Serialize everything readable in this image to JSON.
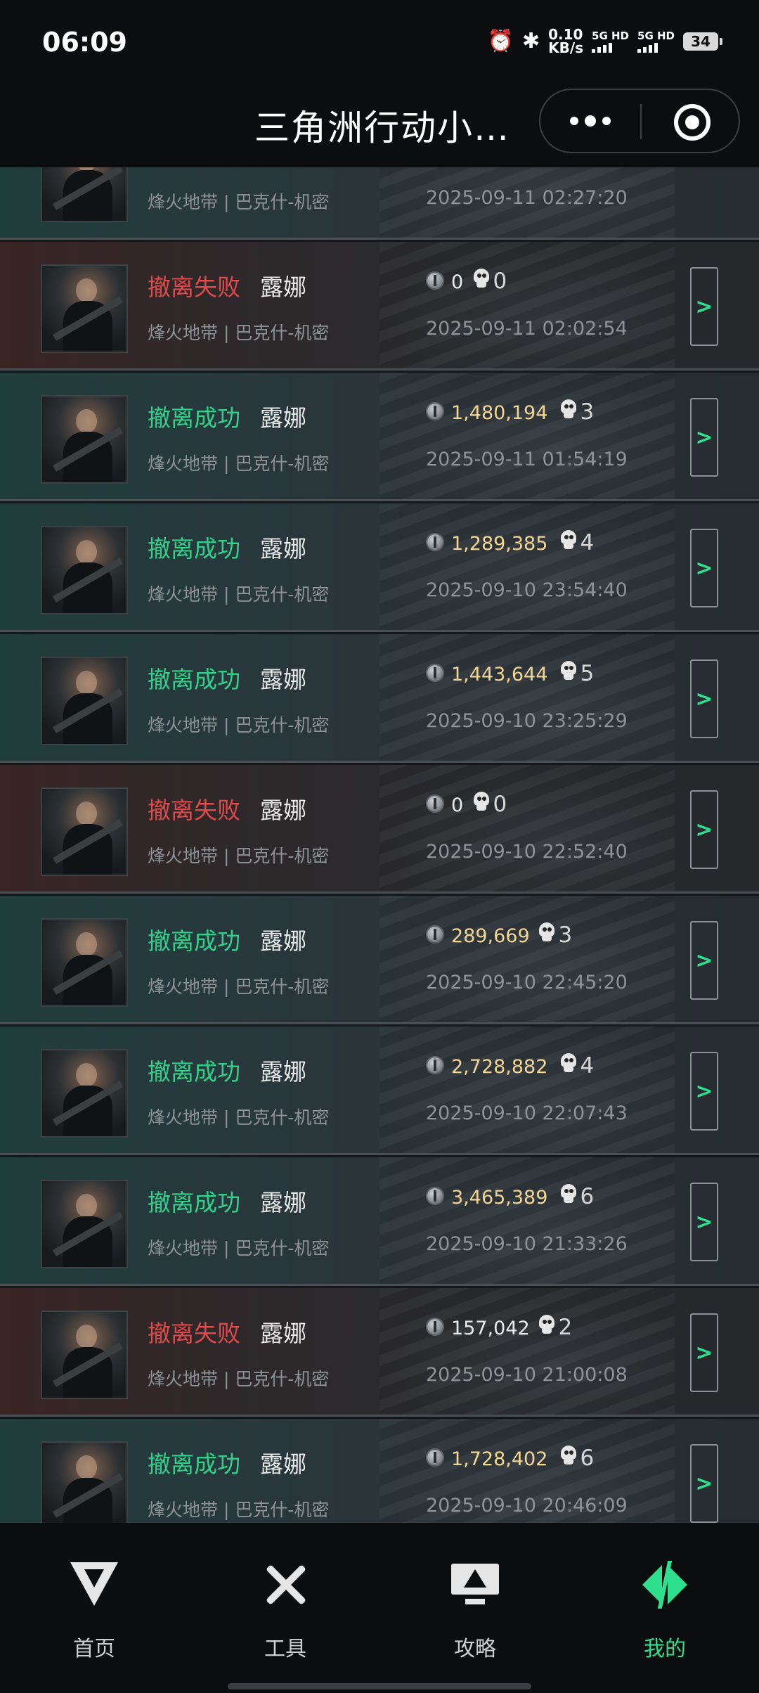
{
  "status_bar": {
    "time": "06:09",
    "net_speed_value": "0.10",
    "net_speed_unit": "KB/s",
    "sim1": "5G HD",
    "sim2": "5G HD",
    "battery": "34",
    "alarm_icon": "alarm-icon",
    "bluetooth_icon": "bluetooth-icon"
  },
  "header": {
    "title": "三角洲行动小…",
    "more_icon": "more-dots-icon",
    "close_icon": "miniprogram-close-icon"
  },
  "records": [
    {
      "status": "",
      "operator": "",
      "mode": "烽火地带 | 巴克什-机密",
      "value": "",
      "kills": "",
      "time": "2025-09-11 02:27:20",
      "result": "partial"
    },
    {
      "status": "撤离失败",
      "operator": "露娜",
      "mode": "烽火地带 | 巴克什-机密",
      "value": "0",
      "kills": "0",
      "time": "2025-09-11 02:02:54",
      "result": "fail"
    },
    {
      "status": "撤离成功",
      "operator": "露娜",
      "mode": "烽火地带 | 巴克什-机密",
      "value": "1,480,194",
      "kills": "3",
      "time": "2025-09-11 01:54:19",
      "result": "success"
    },
    {
      "status": "撤离成功",
      "operator": "露娜",
      "mode": "烽火地带 | 巴克什-机密",
      "value": "1,289,385",
      "kills": "4",
      "time": "2025-09-10 23:54:40",
      "result": "success"
    },
    {
      "status": "撤离成功",
      "operator": "露娜",
      "mode": "烽火地带 | 巴克什-机密",
      "value": "1,443,644",
      "kills": "5",
      "time": "2025-09-10 23:25:29",
      "result": "success"
    },
    {
      "status": "撤离失败",
      "operator": "露娜",
      "mode": "烽火地带 | 巴克什-机密",
      "value": "0",
      "kills": "0",
      "time": "2025-09-10 22:52:40",
      "result": "fail"
    },
    {
      "status": "撤离成功",
      "operator": "露娜",
      "mode": "烽火地带 | 巴克什-机密",
      "value": "289,669",
      "kills": "3",
      "time": "2025-09-10 22:45:20",
      "result": "success"
    },
    {
      "status": "撤离成功",
      "operator": "露娜",
      "mode": "烽火地带 | 巴克什-机密",
      "value": "2,728,882",
      "kills": "4",
      "time": "2025-09-10 22:07:43",
      "result": "success"
    },
    {
      "status": "撤离成功",
      "operator": "露娜",
      "mode": "烽火地带 | 巴克什-机密",
      "value": "3,465,389",
      "kills": "6",
      "time": "2025-09-10 21:33:26",
      "result": "success"
    },
    {
      "status": "撤离失败",
      "operator": "露娜",
      "mode": "烽火地带 | 巴克什-机密",
      "value": "157,042",
      "kills": "2",
      "time": "2025-09-10 21:00:08",
      "result": "fail"
    },
    {
      "status": "撤离成功",
      "operator": "露娜",
      "mode": "烽火地带 | 巴克什-机密",
      "value": "1,728,402",
      "kills": "6",
      "time": "2025-09-10 20:46:09",
      "result": "success"
    }
  ],
  "detail_glyph": ">",
  "tabs": [
    {
      "label": "首页",
      "icon": "home-delta-icon",
      "active": false
    },
    {
      "label": "工具",
      "icon": "tools-icon",
      "active": false
    },
    {
      "label": "攻略",
      "icon": "guide-monitor-icon",
      "active": false
    },
    {
      "label": "我的",
      "icon": "profile-icon",
      "active": true
    }
  ],
  "colors": {
    "success": "#33d08a",
    "fail": "#e04a4a",
    "gold_value": "#f2d493",
    "active_tab": "#2ee08e"
  }
}
